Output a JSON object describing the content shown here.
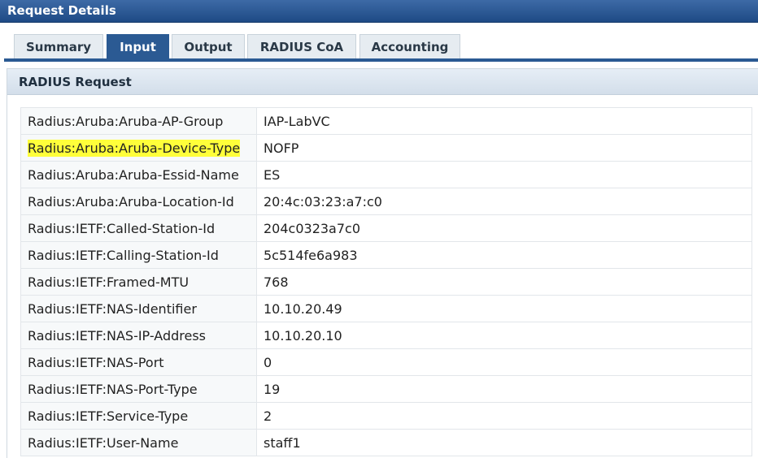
{
  "window": {
    "title": "Request Details"
  },
  "tabs": [
    {
      "label": "Summary",
      "active": false
    },
    {
      "label": "Input",
      "active": true
    },
    {
      "label": "Output",
      "active": false
    },
    {
      "label": "RADIUS CoA",
      "active": false
    },
    {
      "label": "Accounting",
      "active": false
    }
  ],
  "panel": {
    "title": "RADIUS Request"
  },
  "attributes": [
    {
      "name": "Radius:Aruba:Aruba-AP-Group",
      "value": "IAP-LabVC"
    },
    {
      "name": "Radius:Aruba:Aruba-Device-Type",
      "value": "NOFP",
      "highlighted": true
    },
    {
      "name": "Radius:Aruba:Aruba-Essid-Name",
      "value": "ES"
    },
    {
      "name": "Radius:Aruba:Aruba-Location-Id",
      "value": "20:4c:03:23:a7:c0"
    },
    {
      "name": "Radius:IETF:Called-Station-Id",
      "value": "204c0323a7c0"
    },
    {
      "name": "Radius:IETF:Calling-Station-Id",
      "value": "5c514fe6a983"
    },
    {
      "name": "Radius:IETF:Framed-MTU",
      "value": "768"
    },
    {
      "name": "Radius:IETF:NAS-Identifier",
      "value": "10.10.20.49"
    },
    {
      "name": "Radius:IETF:NAS-IP-Address",
      "value": "10.10.20.10"
    },
    {
      "name": "Radius:IETF:NAS-Port",
      "value": "0"
    },
    {
      "name": "Radius:IETF:NAS-Port-Type",
      "value": "19"
    },
    {
      "name": "Radius:IETF:Service-Type",
      "value": "2"
    },
    {
      "name": "Radius:IETF:User-Name",
      "value": "staff1"
    }
  ],
  "colors": {
    "header_blue": "#2b5a93",
    "highlight": "#ffff3a"
  }
}
